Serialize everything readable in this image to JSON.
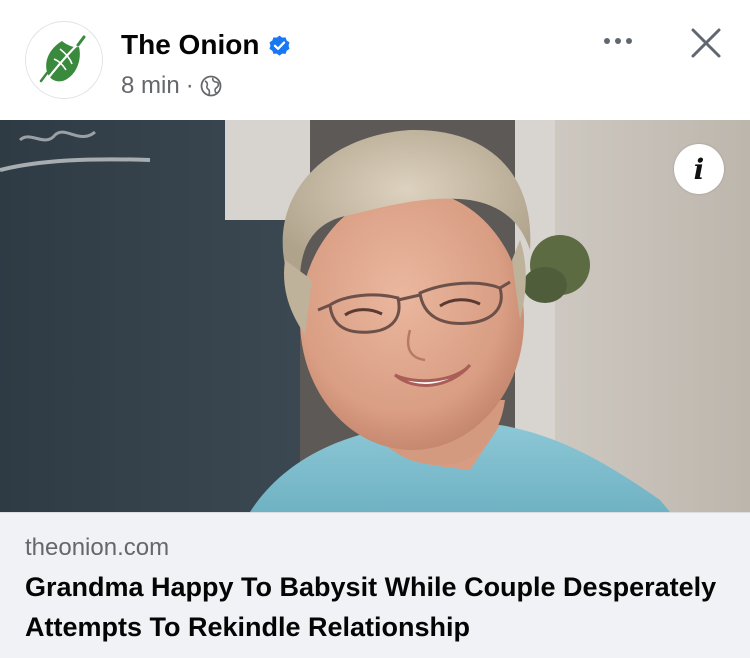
{
  "post": {
    "page_name": "The Onion",
    "verified_icon": "verified-badge-icon",
    "time": "8 min",
    "separator": "·",
    "audience_icon": "globe-icon",
    "more_icon": "more-dots-icon",
    "close_icon": "close-icon"
  },
  "photo": {
    "info_label": "i"
  },
  "link": {
    "domain": "theonion.com",
    "headline": "Grandma Happy To Babysit While Couple Desperately Attempts To Rekindle Relationship"
  },
  "colors": {
    "brand_green": "#3a8a3e",
    "verified_blue": "#1877f2",
    "secondary_text": "#65676b",
    "card_bg": "#f0f2f5"
  }
}
